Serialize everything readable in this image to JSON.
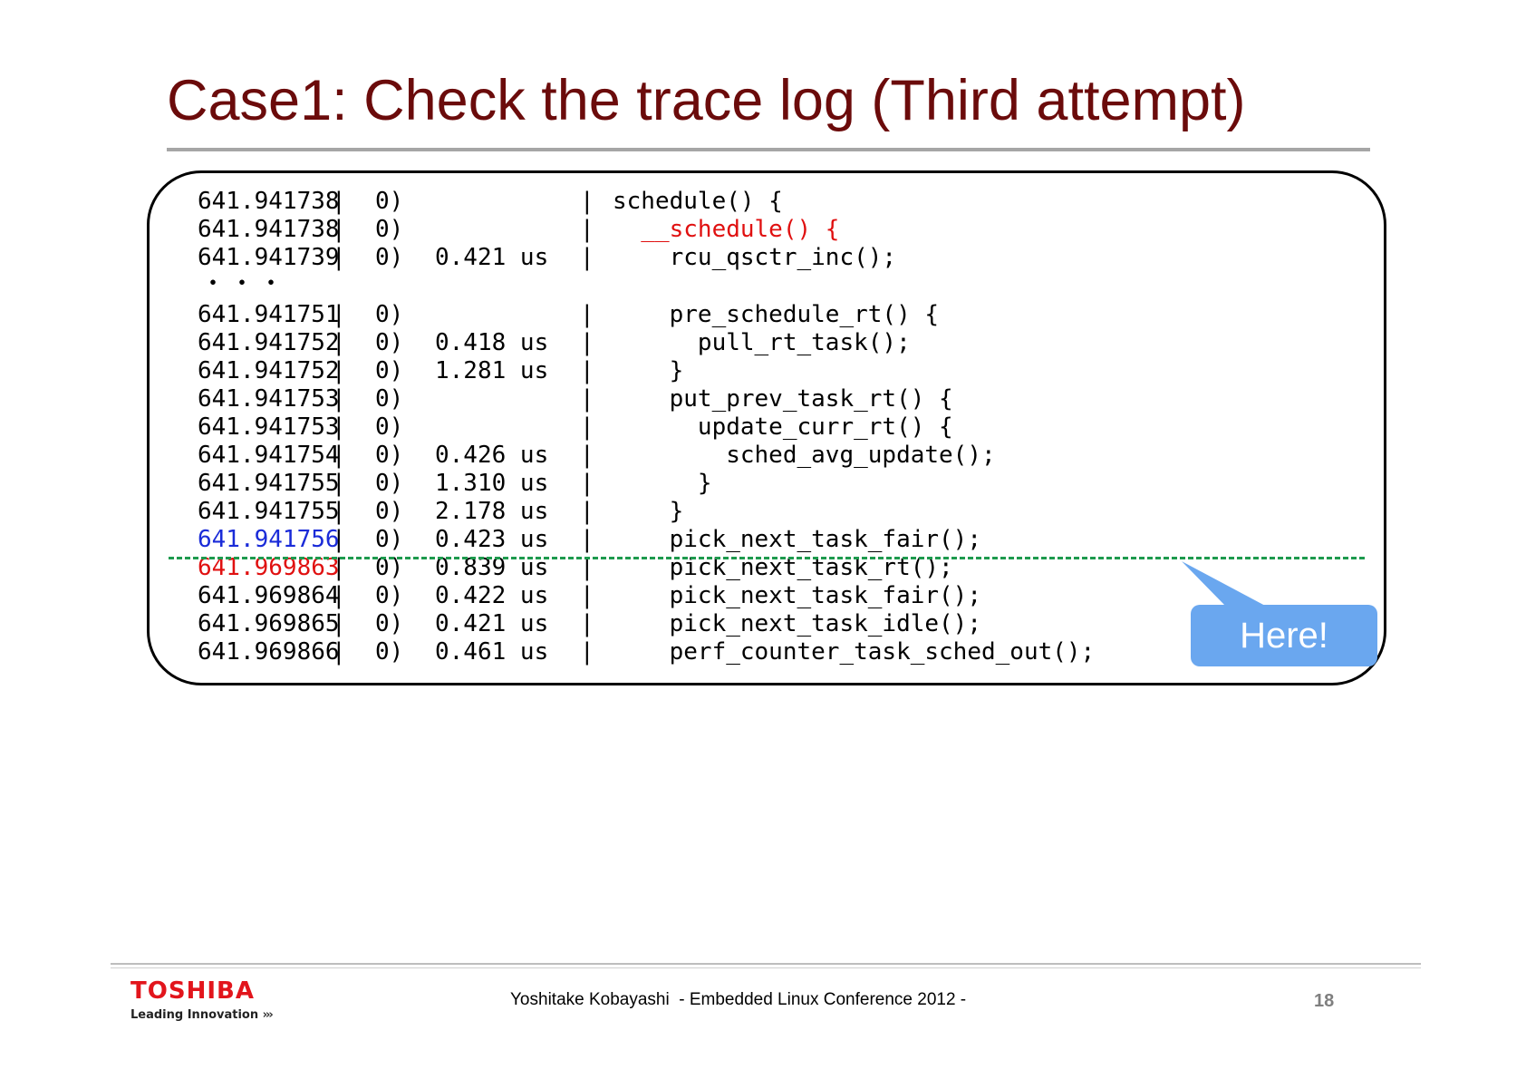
{
  "title": "Case1: Check the trace log (Third attempt)",
  "trace": {
    "ellipsis": "・・・",
    "rows": [
      {
        "ts": "641.941738",
        "cpu": "0)",
        "dur": "",
        "func": "schedule() {"
      },
      {
        "ts": "641.941738",
        "cpu": "0)",
        "dur": "",
        "func": "  __schedule() {"
      },
      {
        "ts": "641.941739",
        "cpu": "0)",
        "dur": "0.421 us",
        "func": "    rcu_qsctr_inc();"
      },
      {
        "ts": "641.941751",
        "cpu": "0)",
        "dur": "",
        "func": "    pre_schedule_rt() {"
      },
      {
        "ts": "641.941752",
        "cpu": "0)",
        "dur": "0.418 us",
        "func": "      pull_rt_task();"
      },
      {
        "ts": "641.941752",
        "cpu": "0)",
        "dur": "1.281 us",
        "func": "    }"
      },
      {
        "ts": "641.941753",
        "cpu": "0)",
        "dur": "",
        "func": "    put_prev_task_rt() {"
      },
      {
        "ts": "641.941753",
        "cpu": "0)",
        "dur": "",
        "func": "      update_curr_rt() {"
      },
      {
        "ts": "641.941754",
        "cpu": "0)",
        "dur": "0.426 us",
        "func": "        sched_avg_update();"
      },
      {
        "ts": "641.941755",
        "cpu": "0)",
        "dur": "1.310 us",
        "func": "      }"
      },
      {
        "ts": "641.941755",
        "cpu": "0)",
        "dur": "2.178 us",
        "func": "    }"
      },
      {
        "ts": "641.941756",
        "cpu": "0)",
        "dur": "0.423 us",
        "func": "    pick_next_task_fair();"
      },
      {
        "ts": "641.969863",
        "cpu": "0)",
        "dur": "0.839 us",
        "func": "    pick_next_task_rt();"
      },
      {
        "ts": "641.969864",
        "cpu": "0)",
        "dur": "0.422 us",
        "func": "    pick_next_task_fair();"
      },
      {
        "ts": "641.969865",
        "cpu": "0)",
        "dur": "0.421 us",
        "func": "    pick_next_task_idle();"
      },
      {
        "ts": "641.969866",
        "cpu": "0)",
        "dur": "0.461 us",
        "func": "    perf_counter_task_sched_out();"
      }
    ]
  },
  "colors": {
    "title": "#6b0b0b",
    "highlight_blue": "#1a2bd8",
    "highlight_red": "#e01010",
    "gap_line": "#1e9a4e",
    "callout": "#6aa7ef",
    "logo": "#e2151c"
  },
  "callout": {
    "text": "Here!"
  },
  "footer": {
    "logo_name": "TOSHIBA",
    "logo_tagline": "Leading Innovation",
    "logo_chevrons": "›››",
    "presenter": "Yoshitake Kobayashi  - Embedded Linux Conference 2012 -",
    "page": "18"
  }
}
